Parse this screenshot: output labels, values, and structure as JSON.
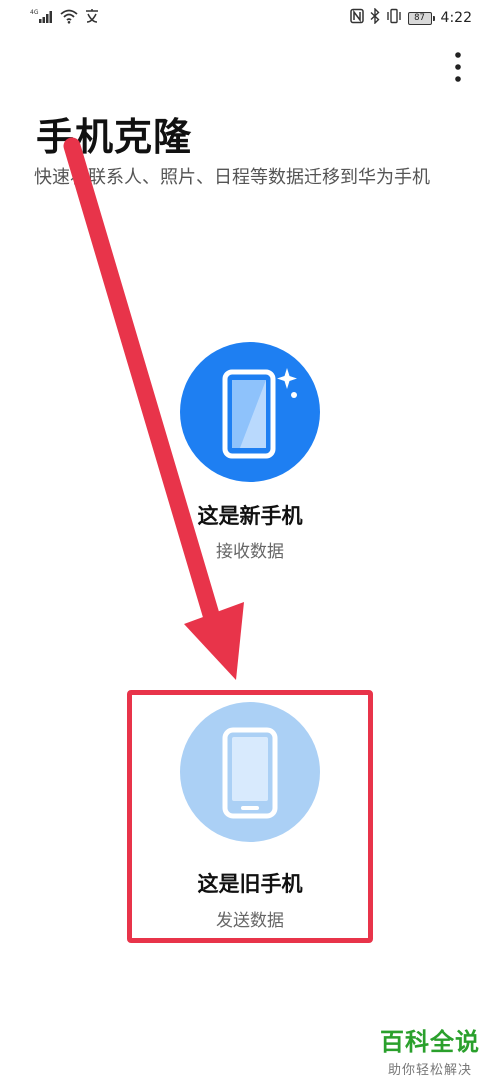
{
  "status_bar": {
    "network": "4G",
    "battery": "87",
    "time": "4:22",
    "icons": [
      "signal-icon",
      "wifi-icon",
      "notification-app-icon",
      "nfc-icon",
      "bluetooth-icon",
      "vibrate-icon",
      "battery-icon"
    ]
  },
  "menu": {
    "icon": "more-vertical-icon"
  },
  "header": {
    "title": "手机克隆",
    "subtitle": "快速将联系人、照片、日程等数据迁移到华为手机"
  },
  "options": {
    "new_phone": {
      "label": "这是新手机",
      "sublabel": "接收数据",
      "icon": "phone-sparkle-icon",
      "color": "#1e7ff2"
    },
    "old_phone": {
      "label": "这是旧手机",
      "sublabel": "发送数据",
      "icon": "phone-icon",
      "color": "#abd0f5"
    }
  },
  "annotation": {
    "arrow_color": "#e8344a",
    "box_color": "#e8344a"
  },
  "watermark": {
    "title": "百科全说",
    "subtitle": "助你轻松解决",
    "color": "#2aa02c"
  }
}
